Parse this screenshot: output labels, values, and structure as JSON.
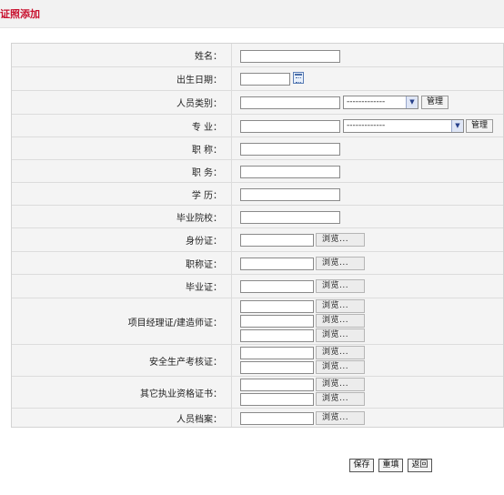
{
  "page": {
    "title": "证照添加"
  },
  "form": {
    "name_label": "姓名：",
    "birth_label": "出生日期：",
    "category_label": "人员类别：",
    "category_select": "-------------",
    "major_label": "专  业：",
    "major_select": "-------------",
    "manage_label": "管理",
    "title_label": "职  称：",
    "position_label": "职  务：",
    "education_label": "学  历：",
    "school_label": "毕业院校：",
    "idcard_label": "身份证：",
    "titlecert_label": "职称证：",
    "gradcert_label": "毕业证：",
    "pmcert_label": "项目经理证/建造师证：",
    "safety_label": "安全生产考核证：",
    "other_label": "其它执业资格证书：",
    "archive_label": "人员档案：",
    "browse_label": "浏览..."
  },
  "actions": {
    "save": "保存",
    "reset": "重填",
    "back": "返回"
  }
}
